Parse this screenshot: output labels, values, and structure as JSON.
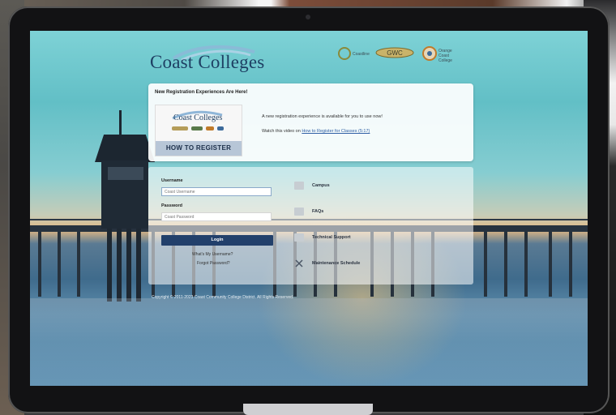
{
  "header": {
    "logo_text": "Coast Colleges",
    "partner_logos": [
      "Coastline",
      "GWC",
      "Orange Coast College"
    ]
  },
  "announcement": {
    "title": "New Registration Experiences Are Here!",
    "card_logo_text": "Coast Colleges",
    "card_label": "HOW TO REGISTER",
    "text1": "A new registration experience is available for you to use now!",
    "text2_prefix": "Watch this video on ",
    "text2_link": "How to Register for Classes (5:17)"
  },
  "login": {
    "username_label": "Username",
    "username_placeholder": "Coast Username",
    "password_label": "Password",
    "password_placeholder": "Coast Password",
    "login_button": "Login",
    "forgot_username": "What's My Username?",
    "forgot_password": "Forgot Password?"
  },
  "side_links": [
    {
      "label": "Campus",
      "icon": "building-icon"
    },
    {
      "label": "FAQs",
      "icon": "help-icon"
    },
    {
      "label": "Technical Support",
      "icon": "support-icon"
    },
    {
      "label": "Maintenance Schedule",
      "icon": "tools-icon"
    }
  ],
  "footer": {
    "copyright": "Copyright © 2011-2023 Coast Community College District. All Rights Reserved."
  },
  "colors": {
    "brand_navy": "#22406b",
    "logo_blue": "#1e3f63",
    "link_blue": "#2f5fa5"
  }
}
